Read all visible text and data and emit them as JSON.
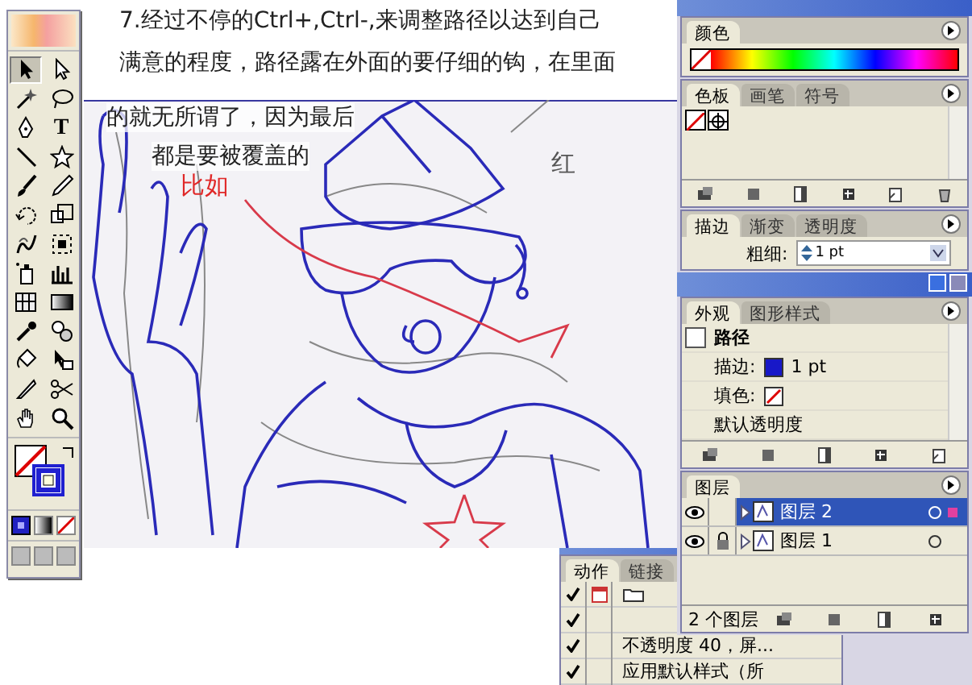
{
  "toolbox": {
    "tools": [
      {
        "kind": "select",
        "selected": true
      },
      {
        "kind": "direct-select",
        "selected": false
      },
      {
        "kind": "wand",
        "selected": false
      },
      {
        "kind": "lasso",
        "selected": false
      },
      {
        "kind": "pen",
        "selected": false
      },
      {
        "kind": "type",
        "glyph": "T",
        "selected": false
      },
      {
        "kind": "line",
        "selected": false
      },
      {
        "kind": "star",
        "selected": false
      },
      {
        "kind": "brush",
        "selected": false
      },
      {
        "kind": "pencil",
        "selected": false
      },
      {
        "kind": "rotate",
        "selected": false
      },
      {
        "kind": "scale",
        "selected": false
      },
      {
        "kind": "warp",
        "selected": false
      },
      {
        "kind": "free-transform",
        "selected": false
      },
      {
        "kind": "sprayer",
        "selected": false
      },
      {
        "kind": "graph",
        "selected": false
      },
      {
        "kind": "mesh",
        "selected": false
      },
      {
        "kind": "gradient",
        "selected": false
      },
      {
        "kind": "eyedropper",
        "selected": false
      },
      {
        "kind": "blend",
        "selected": false
      },
      {
        "kind": "bucket",
        "selected": false
      },
      {
        "kind": "live-select",
        "selected": false
      },
      {
        "kind": "slice",
        "selected": false
      },
      {
        "kind": "scissors",
        "selected": false
      },
      {
        "kind": "hand",
        "selected": false
      },
      {
        "kind": "zoom",
        "selected": false
      }
    ],
    "color_modes": [
      {
        "kind": "color",
        "selected": true
      },
      {
        "kind": "gradient",
        "selected": false
      },
      {
        "kind": "none",
        "selected": false
      }
    ]
  },
  "canvas": {
    "note_lines": [
      "7.经过不停的Ctrl+,Ctrl-,来调整路径以达到自己",
      "满意的程度，路径露在外面的要仔细的钩，在里面",
      "的就无所谓了，因为最后",
      "都是要被覆盖的"
    ],
    "handwriting": [
      {
        "text": "比如",
        "color": "#e02828"
      },
      {
        "text": "红",
        "color": "#555555"
      }
    ]
  },
  "color_panel": {
    "tabs": [
      {
        "label": "颜色",
        "selected": true
      }
    ]
  },
  "swatches_panel": {
    "tabs": [
      {
        "label": "色板",
        "selected": true
      },
      {
        "label": "画笔",
        "selected": false
      },
      {
        "label": "符号",
        "selected": false
      }
    ]
  },
  "stroke_panel": {
    "tabs": [
      {
        "label": "描边",
        "selected": true
      },
      {
        "label": "渐变",
        "selected": false
      },
      {
        "label": "透明度",
        "selected": false
      }
    ],
    "weight_label": "粗细:",
    "weight_value": "1 pt"
  },
  "appearance_panel": {
    "tabs": [
      {
        "label": "外观",
        "selected": true
      },
      {
        "label": "图形样式",
        "selected": false
      }
    ],
    "target": "路径",
    "rows": [
      {
        "kind": "stroke",
        "label": "描边:",
        "value": "1 pt"
      },
      {
        "kind": "fill",
        "label": "填色:"
      },
      {
        "kind": "plain",
        "label": "默认透明度"
      }
    ]
  },
  "layers_panel": {
    "tabs": [
      {
        "label": "图层",
        "selected": true
      }
    ],
    "layers": [
      {
        "name": "图层 2",
        "selected": true,
        "locked": false
      },
      {
        "name": "图层 1",
        "selected": false,
        "locked": true
      }
    ],
    "footer": "2 个图层"
  },
  "actions_panel": {
    "tabs": [
      {
        "label": "动作",
        "selected": true
      },
      {
        "label": "链接",
        "selected": false
      }
    ],
    "items": [
      {
        "kind": "set",
        "checked": true
      },
      {
        "kind": "hidden",
        "checked": true
      },
      {
        "kind": "action",
        "checked": true,
        "label": "不透明度 40，屏..."
      },
      {
        "kind": "action",
        "checked": true,
        "label": "应用默认样式（所"
      }
    ]
  }
}
